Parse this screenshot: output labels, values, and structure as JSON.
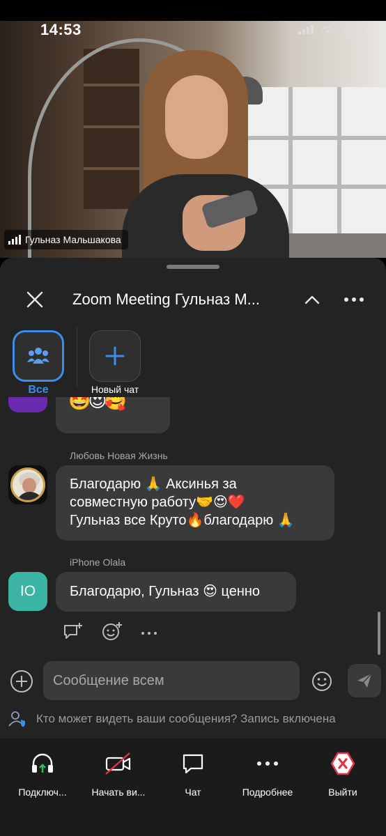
{
  "status_bar": {
    "time": "14:53"
  },
  "video": {
    "participant_name": "Гульназ Мальшакова"
  },
  "chat": {
    "title": "Zoom Meeting Гульназ М...",
    "filters": [
      {
        "label": "Все",
        "icon": "people-icon",
        "selected": true
      },
      {
        "label": "Новый чат",
        "icon": "plus-icon",
        "selected": false
      }
    ],
    "messages": [
      {
        "sender": "",
        "text": "🤩😍🥰",
        "partial": true
      },
      {
        "sender": "Любовь Новая Жизнь",
        "avatar": "photo",
        "text_lines": [
          "Благодарю 🙏 Аксинья за",
          "совместную работу🤝😍❤️",
          "Гульназ все Круто🔥благодарю 🙏"
        ]
      },
      {
        "sender": "iPhone Olala",
        "avatar_initials": "IO",
        "text": "Благодарю, Гульназ 😍 ценно"
      }
    ],
    "composer": {
      "placeholder": "Сообщение всем"
    },
    "privacy_notice": "Кто может видеть ваши сообщения? Запись включена"
  },
  "toolbar": {
    "items": [
      {
        "label": "Подключ...",
        "icon": "headphones-icon"
      },
      {
        "label": "Начать ви...",
        "icon": "video-off-icon"
      },
      {
        "label": "Чат",
        "icon": "chat-icon"
      },
      {
        "label": "Подробнее",
        "icon": "more-icon"
      },
      {
        "label": "Выйти",
        "icon": "leave-icon"
      }
    ]
  },
  "colors": {
    "accent": "#3d8eea",
    "sheet_bg": "#232323",
    "bubble_bg": "#3a3a3a",
    "leave_red": "#e0334b",
    "avatar_teal": "#3cb4a4"
  }
}
